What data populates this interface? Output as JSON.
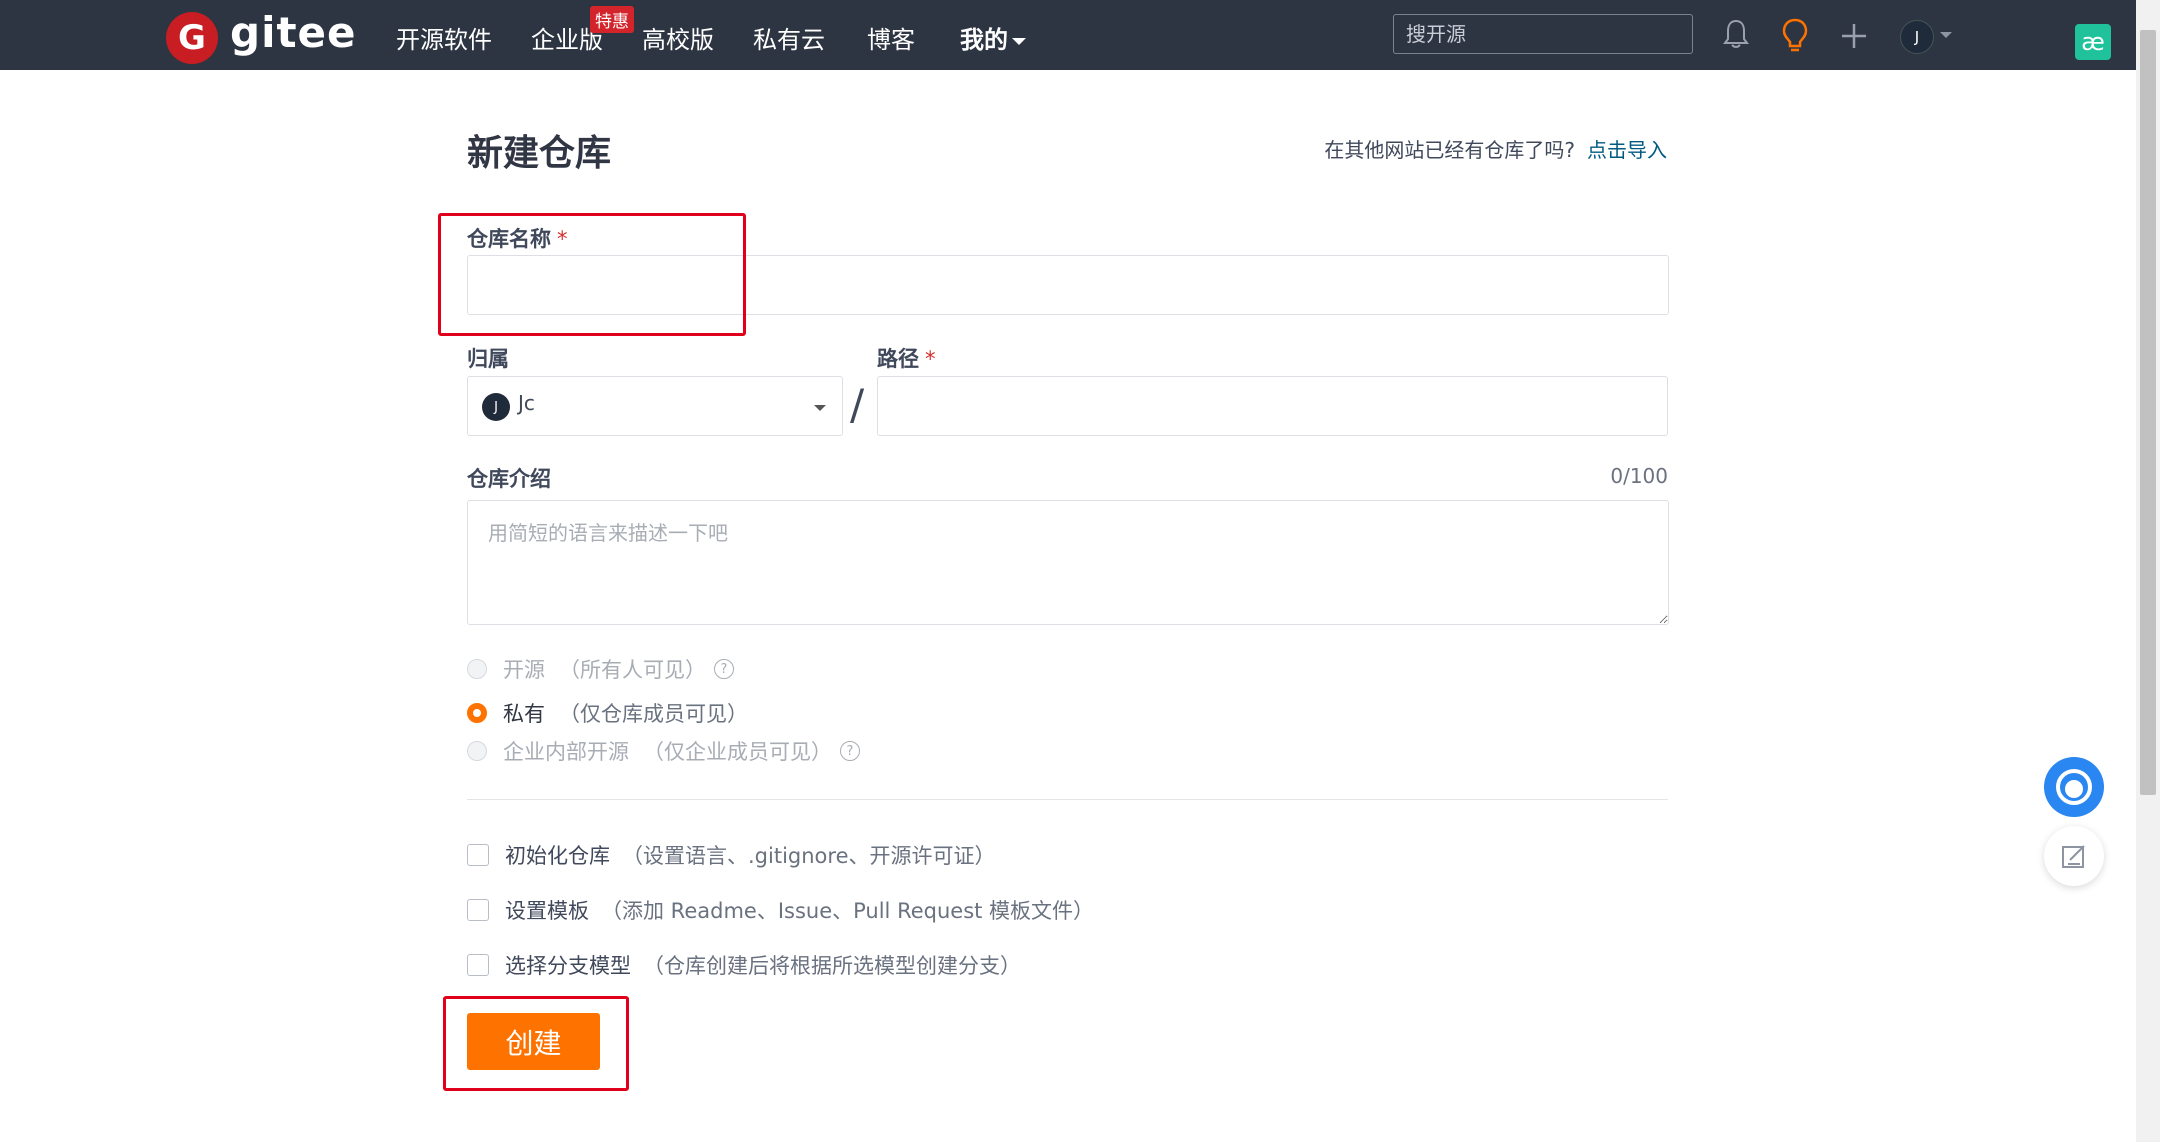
{
  "nav": {
    "logo_text": "gitee",
    "items": [
      "开源软件",
      "企业版",
      "高校版",
      "私有云",
      "博客",
      "我的"
    ],
    "badge": "特惠",
    "search_placeholder": "搜开源",
    "avatar_letter": "J"
  },
  "form": {
    "title": "新建仓库",
    "import_hint": "在其他网站已经有仓库了吗?",
    "import_link": "点击导入",
    "repo_name_label": "仓库名称",
    "required_mark": "*",
    "owner_label": "归属",
    "owner_avatar": "J",
    "owner_name": "Jc",
    "path_label": "路径",
    "slash": "/",
    "desc_label": "仓库介绍",
    "desc_counter": "0/100",
    "desc_placeholder": "用简短的语言来描述一下吧",
    "visibility": [
      {
        "label": "开源",
        "desc": "（所有人可见）",
        "selected": false,
        "disabled": true,
        "help": true
      },
      {
        "label": "私有",
        "desc": "（仅仓库成员可见）",
        "selected": true,
        "disabled": false,
        "help": false
      },
      {
        "label": "企业内部开源",
        "desc": "（仅企业成员可见）",
        "selected": false,
        "disabled": true,
        "help": true
      }
    ],
    "options": [
      {
        "label": "初始化仓库",
        "desc": "（设置语言、.gitignore、开源许可证）"
      },
      {
        "label": "设置模板",
        "desc": "（添加 Readme、Issue、Pull Request 模板文件）"
      },
      {
        "label": "选择分支模型",
        "desc": "（仓库创建后将根据所选模型创建分支）"
      }
    ],
    "create_button": "创建"
  },
  "colors": {
    "nav_bg": "#2e3542",
    "accent": "#fe7300",
    "logo_red": "#c71d23",
    "annotation_red": "#e0001b",
    "link": "#005980"
  },
  "icons": [
    "gitee-logo-icon",
    "bell-icon",
    "bulb-icon",
    "plus-icon",
    "customer-service-icon",
    "edit-feedback-icon"
  ]
}
